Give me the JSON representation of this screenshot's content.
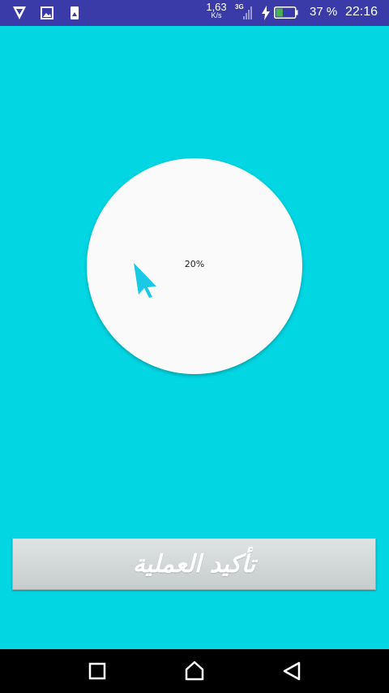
{
  "status_bar": {
    "net_speed_value": "1,63",
    "net_speed_unit": "K/s",
    "network_type": "3G",
    "battery_percent": "37 %",
    "battery_level": 0.37,
    "time": "22:16",
    "icons": [
      "shield-app-icon",
      "gallery-icon",
      "sim-app-icon",
      "signal-icon",
      "charging-icon",
      "battery-icon"
    ]
  },
  "progress": {
    "label": "20%",
    "value": 0.2
  },
  "confirm_button": {
    "label": "تأكيد العملية"
  },
  "nav_bar": {
    "icons": [
      "recents-icon",
      "home-icon",
      "back-icon"
    ]
  },
  "colors": {
    "background": "#02d6e3",
    "status_bar": "#3a3aa8",
    "circle": "#fafafa",
    "pointer": "#19c9e6",
    "button": "#d4d8d8",
    "nav_bar": "#000000"
  }
}
